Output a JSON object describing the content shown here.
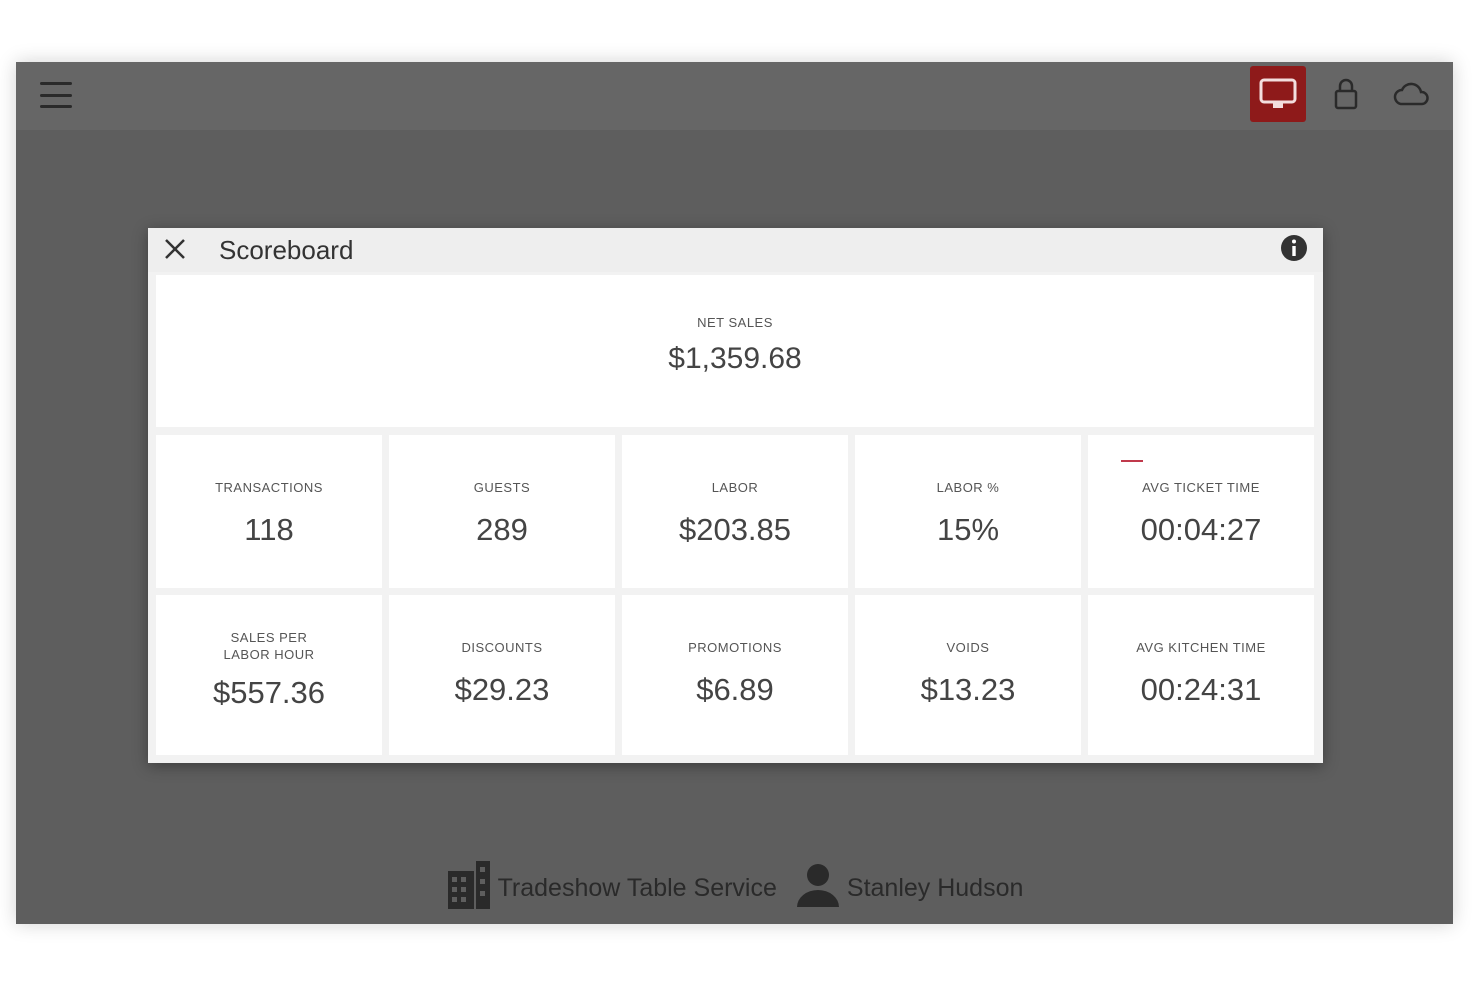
{
  "toolbar": {
    "menu_icon": "hamburger-menu-icon",
    "display_icon": "monitor-icon",
    "lock_icon": "lock-icon",
    "cloud_icon": "cloud-icon",
    "accent_color": "#8e1a1a"
  },
  "modal": {
    "title": "Scoreboard",
    "close_icon": "close-icon",
    "info_icon": "info-icon",
    "net_sales": {
      "label": "NET SALES",
      "value": "$1,359.68"
    },
    "tiles": [
      {
        "label": "TRANSACTIONS",
        "value": "118"
      },
      {
        "label": "GUESTS",
        "value": "289"
      },
      {
        "label": "LABOR",
        "value": "$203.85"
      },
      {
        "label": "LABOR %",
        "value": "15%"
      },
      {
        "label": "AVG TICKET TIME",
        "value": "00:04:27"
      },
      {
        "label": "SALES PER LABOR HOUR",
        "value": "$557.36"
      },
      {
        "label": "DISCOUNTS",
        "value": "$29.23"
      },
      {
        "label": "PROMOTIONS",
        "value": "$6.89"
      },
      {
        "label": "VOIDS",
        "value": "$13.23"
      },
      {
        "label": "AVG KITCHEN TIME",
        "value": "00:24:31"
      }
    ]
  },
  "footer": {
    "location_icon": "building-icon",
    "location": "Tradeshow Table Service",
    "user_icon": "person-icon",
    "user": "Stanley Hudson"
  }
}
